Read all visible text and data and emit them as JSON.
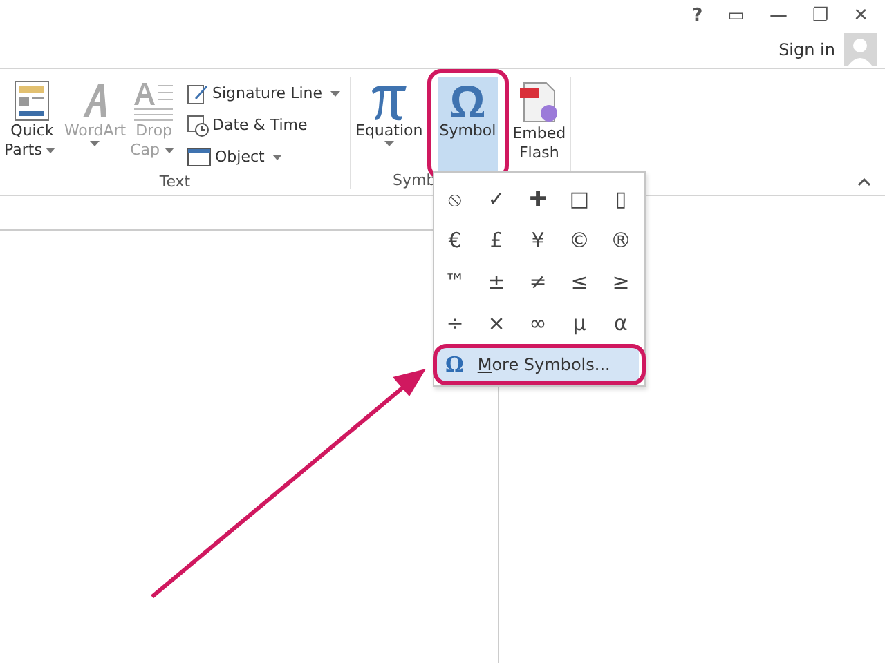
{
  "window_controls": [
    "?",
    "▭",
    "—",
    "❐",
    "✕"
  ],
  "account": {
    "label": "Sign in"
  },
  "ribbon": {
    "groups": [
      {
        "label": "Text",
        "large_buttons": [
          {
            "kind": "quickparts",
            "label": [
              "Quick",
              "Parts"
            ],
            "dropdown": true,
            "disabled": false,
            "selected": false
          },
          {
            "kind": "wordart",
            "label": [
              "WordArt"
            ],
            "dropdown": true,
            "disabled": true,
            "selected": false
          },
          {
            "kind": "dropcap",
            "label": [
              "Drop",
              "Cap"
            ],
            "dropdown": true,
            "disabled": true,
            "selected": false
          }
        ],
        "small_buttons": [
          {
            "kind": "signature",
            "label": "Signature Line",
            "dropdown": true
          },
          {
            "kind": "datetime",
            "label": "Date & Time",
            "dropdown": false
          },
          {
            "kind": "object",
            "label": "Object",
            "dropdown": true
          }
        ]
      },
      {
        "label": "Symb",
        "large_buttons": [
          {
            "kind": "equation",
            "label": [
              "Equation"
            ],
            "dropdown": true,
            "disabled": false,
            "selected": false
          },
          {
            "kind": "symbol",
            "label": [
              "Symbol"
            ],
            "dropdown": false,
            "disabled": false,
            "selected": true
          },
          {
            "kind": "flash",
            "label": [
              "Embed",
              "Flash"
            ],
            "dropdown": false,
            "disabled": false,
            "selected": false
          }
        ]
      }
    ]
  },
  "symbol_menu": {
    "symbols": [
      "⦸",
      "✓",
      "✚",
      "□",
      "▯",
      "€",
      "£",
      "¥",
      "©",
      "®",
      "™",
      "±",
      "≠",
      "≤",
      "≥",
      "÷",
      "×",
      "∞",
      "µ",
      "α"
    ],
    "more": {
      "icon": "Ω",
      "label": "More Symbols...",
      "selected": true
    }
  },
  "annotations": {
    "highlight_symbol_button": true,
    "highlight_more_symbols": true,
    "arrow": true
  }
}
